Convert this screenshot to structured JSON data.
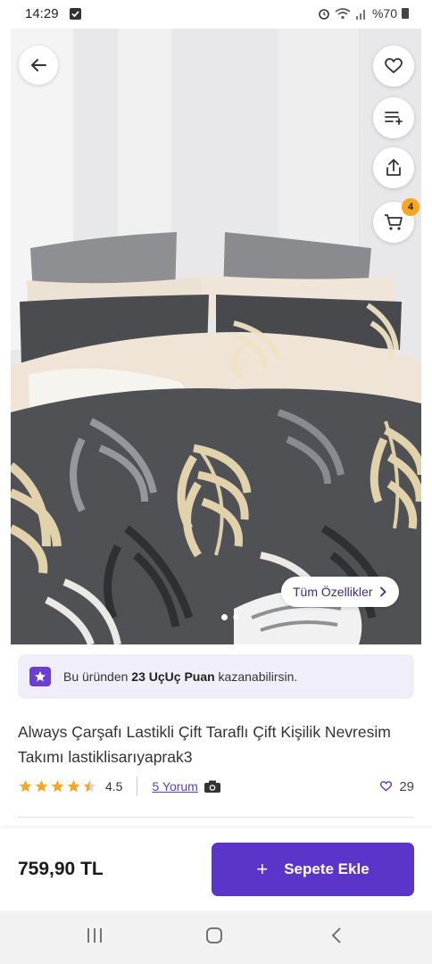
{
  "status_bar": {
    "time": "14:29",
    "battery": "%70",
    "icons": [
      "check-notification-icon",
      "alarm-icon",
      "wifi-icon",
      "signal-icon",
      "battery-icon"
    ]
  },
  "product_image": {
    "description_icons": [
      "back-arrow-icon",
      "heart-icon",
      "add-to-list-icon",
      "share-icon",
      "cart-icon"
    ],
    "cart_count": "4",
    "features_button_label": "Tüm Özellikler",
    "carousel_index": 1,
    "carousel_total": 2
  },
  "points_banner": {
    "prefix": "Bu üründen ",
    "points": "23 UçUç Puan",
    "suffix": " kazanabilirsin."
  },
  "product": {
    "title": "Always Çarşafı Lastikli Çift Taraflı Çift Kişilik Nevresim Takımı lastiklisarıyaprak3",
    "rating": "4.5",
    "rating_stars": 4.5,
    "reviews_label": "5 Yorum",
    "likes": "29"
  },
  "purchase": {
    "price": "759,90 TL",
    "add_to_cart_label": "Sepete Ekle"
  },
  "colors": {
    "accent": "#5b35c9",
    "star": "#f5a623",
    "banner_bg": "#f0eef8"
  }
}
